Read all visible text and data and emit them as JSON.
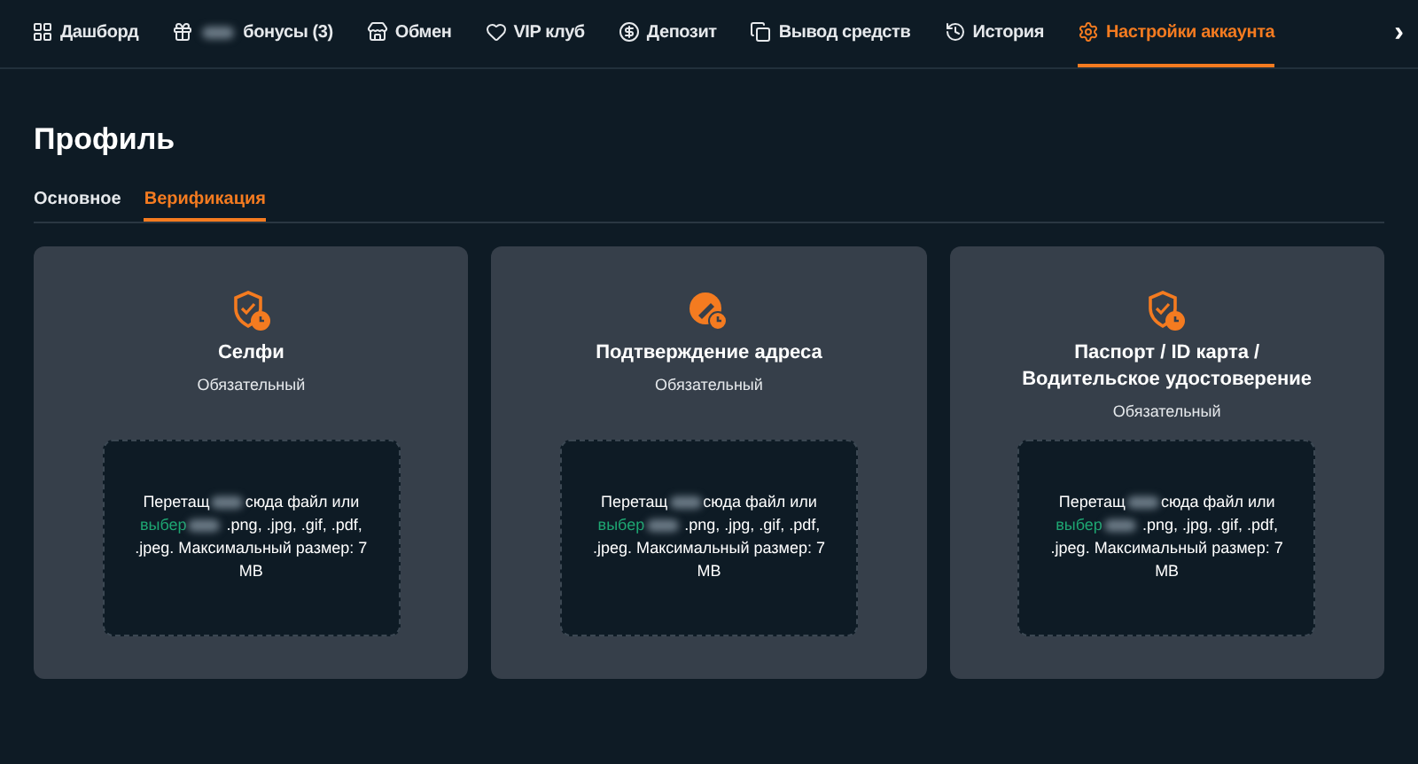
{
  "nav": {
    "items": [
      {
        "kind": "dashboard",
        "label": "Дашборд",
        "blurred_prefix": false,
        "selected": false
      },
      {
        "kind": "gift",
        "label": "бонусы (3)",
        "blurred_prefix": true,
        "selected": false
      },
      {
        "kind": "store",
        "label": "Обмен",
        "blurred_prefix": false,
        "selected": false
      },
      {
        "kind": "heart",
        "label": "VIP клуб",
        "blurred_prefix": false,
        "selected": false
      },
      {
        "kind": "coin",
        "label": "Депозит",
        "blurred_prefix": false,
        "selected": false
      },
      {
        "kind": "withdraw",
        "label": "Вывод средств",
        "blurred_prefix": false,
        "selected": false
      },
      {
        "kind": "history",
        "label": "История",
        "blurred_prefix": false,
        "selected": false
      },
      {
        "kind": "settings",
        "label": "Настройки аккаунта",
        "blurred_prefix": false,
        "selected": true
      }
    ],
    "next": "›"
  },
  "page_title": "Профиль",
  "tabs": [
    {
      "label": "Основное",
      "selected": false
    },
    {
      "label": "Верификация",
      "selected": true
    }
  ],
  "cards": [
    {
      "kind": "shield",
      "title": "Селфи",
      "subtitle": "Обязательный",
      "drop": {
        "start": "Перетащ",
        "middle": "сюда файл или",
        "link": "выбер",
        "end": ".png, .jpg, .gif, .pdf, .jpeg. Максимальный размер: 7 MB"
      }
    },
    {
      "kind": "badge",
      "title": "Подтверждение адреса",
      "subtitle": "Обязательный",
      "drop": {
        "start": "Перетащ",
        "middle": "сюда файл или",
        "link": "выбер",
        "end": ".png, .jpg, .gif, .pdf, .jpeg. Максимальный размер: 7 MB"
      }
    },
    {
      "kind": "shield",
      "title": "Паспорт / ID карта / Водительское удостоверение",
      "subtitle": "Обязательный",
      "drop": {
        "start": "Перетащ",
        "middle": "сюда файл или",
        "link": "выбер",
        "end": ".png, .jpg, .gif, .pdf, .jpeg. Максимальный размер: 7 MB"
      }
    }
  ]
}
